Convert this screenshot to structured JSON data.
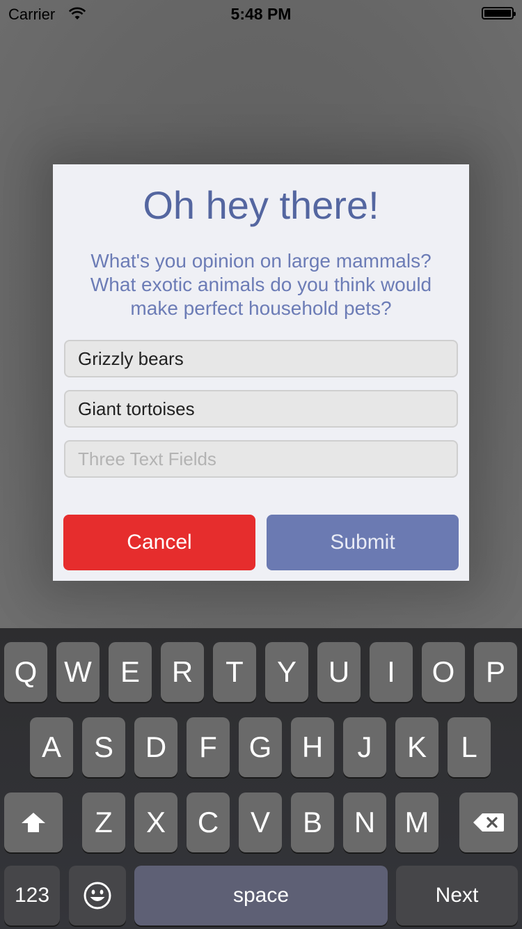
{
  "status_bar": {
    "carrier": "Carrier",
    "time": "5:48 PM"
  },
  "dialog": {
    "title": "Oh hey there!",
    "message_lines": [
      "What's you opinion on large mammals?",
      "What exotic animals do you think would",
      "make perfect household pets?"
    ],
    "fields": [
      {
        "value": "Grizzly bears",
        "placeholder": ""
      },
      {
        "value": "Giant tortoises",
        "placeholder": ""
      },
      {
        "value": "",
        "placeholder": "Three Text Fields"
      }
    ],
    "cancel_label": "Cancel",
    "submit_label": "Submit"
  },
  "keyboard": {
    "row1": [
      "Q",
      "W",
      "E",
      "R",
      "T",
      "Y",
      "U",
      "I",
      "O",
      "P"
    ],
    "row2": [
      "A",
      "S",
      "D",
      "F",
      "G",
      "H",
      "J",
      "K",
      "L"
    ],
    "row3": [
      "Z",
      "X",
      "C",
      "V",
      "B",
      "N",
      "M"
    ],
    "numbers_label": "123",
    "space_label": "space",
    "return_label": "Next",
    "shift_icon": "shift-arrow-icon",
    "delete_icon": "backspace-icon",
    "emoji_icon": "emoji-smiley-icon"
  }
}
